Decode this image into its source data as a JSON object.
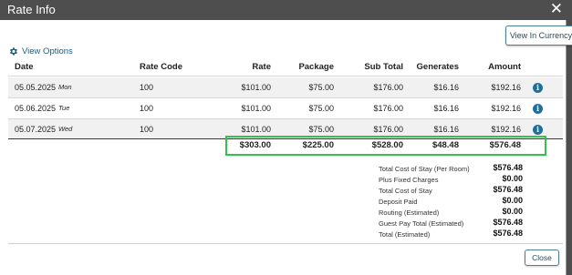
{
  "window": {
    "title": "Rate Info",
    "close_glyph": "✕"
  },
  "toolbar": {
    "view_in_currency": "View In Currency",
    "view_options": "View Options"
  },
  "table": {
    "headers": {
      "date": "Date",
      "rate_code": "Rate Code",
      "rate": "Rate",
      "package": "Package",
      "sub_total": "Sub Total",
      "generates": "Generates",
      "amount": "Amount"
    },
    "rows": [
      {
        "date": "05.05.2025",
        "day": "Mon",
        "rate_code": "100",
        "rate": "$101.00",
        "package": "$75.00",
        "sub_total": "$176.00",
        "generates": "$16.16",
        "amount": "$192.16"
      },
      {
        "date": "05.06.2025",
        "day": "Tue",
        "rate_code": "100",
        "rate": "$101.00",
        "package": "$75.00",
        "sub_total": "$176.00",
        "generates": "$16.16",
        "amount": "$192.16"
      },
      {
        "date": "05.07.2025",
        "day": "Wed",
        "rate_code": "100",
        "rate": "$101.00",
        "package": "$75.00",
        "sub_total": "$176.00",
        "generates": "$16.16",
        "amount": "$192.16"
      }
    ],
    "totals": {
      "rate": "$303.00",
      "package": "$225.00",
      "sub_total": "$528.00",
      "generates": "$48.48",
      "amount": "$576.48"
    },
    "info_glyph": "i"
  },
  "summary": [
    {
      "label": "Total Cost of Stay (Per Room)",
      "value": "$576.48"
    },
    {
      "label": "Plus Fixed Charges",
      "value": "$0.00"
    },
    {
      "label": "Total Cost of Stay",
      "value": "$576.48"
    },
    {
      "label": "Deposit Paid",
      "value": "$0.00"
    },
    {
      "label": "Routing (Estimated)",
      "value": "$0.00"
    },
    {
      "label": "Guest Pay Total (Estimated)",
      "value": "$576.48"
    },
    {
      "label": "Total (Estimated)",
      "value": "$576.48"
    }
  ],
  "footer": {
    "close_label": "Close"
  },
  "colors": {
    "titlebar": "#4e4e4e",
    "accent": "#1f6f9a",
    "highlight": "#33c24a"
  }
}
